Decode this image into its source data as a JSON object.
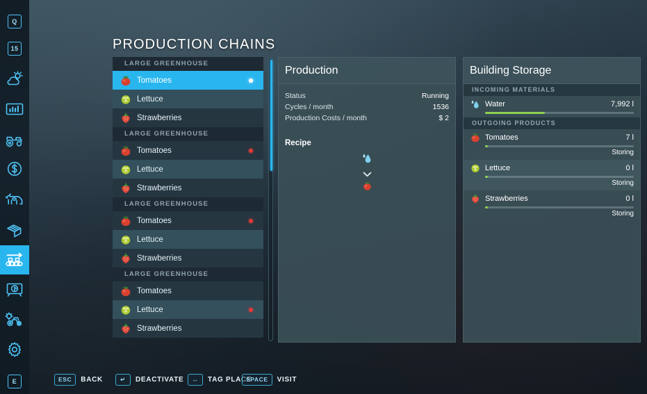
{
  "page": {
    "title": "PRODUCTION CHAINS"
  },
  "sidebar": {
    "items": [
      {
        "name": "quests-icon",
        "label": "Q",
        "active": false
      },
      {
        "name": "calendar-icon",
        "label": "15",
        "active": false
      },
      {
        "name": "weather-icon",
        "label": "",
        "active": false
      },
      {
        "name": "statistics-icon",
        "label": "",
        "active": false
      },
      {
        "name": "vehicles-icon",
        "label": "",
        "active": false
      },
      {
        "name": "finances-icon",
        "label": "",
        "active": false
      },
      {
        "name": "animals-icon",
        "label": "",
        "active": false
      },
      {
        "name": "contracts-icon",
        "label": "",
        "active": false
      },
      {
        "name": "production-chains-icon",
        "label": "",
        "active": true
      },
      {
        "name": "construction-icon",
        "label": "",
        "active": false
      },
      {
        "name": "ai-workers-icon",
        "label": "",
        "active": false
      },
      {
        "name": "settings-icon",
        "label": "",
        "active": false
      },
      {
        "name": "help-key-icon",
        "label": "E",
        "active": false
      }
    ]
  },
  "chain_list": {
    "groups": [
      {
        "header": "LARGE GREENHOUSE",
        "rows": [
          {
            "label": "Tomatoes",
            "icon": "tomato",
            "state": "selected",
            "dot": "white"
          },
          {
            "label": "Lettuce",
            "icon": "lettuce",
            "state": "even",
            "dot": "none"
          },
          {
            "label": "Strawberries",
            "icon": "strawberry",
            "state": "odd",
            "dot": "none"
          }
        ]
      },
      {
        "header": "LARGE GREENHOUSE",
        "rows": [
          {
            "label": "Tomatoes",
            "icon": "tomato",
            "state": "odd",
            "dot": "red"
          },
          {
            "label": "Lettuce",
            "icon": "lettuce",
            "state": "even",
            "dot": "none"
          },
          {
            "label": "Strawberries",
            "icon": "strawberry",
            "state": "odd",
            "dot": "none"
          }
        ]
      },
      {
        "header": "LARGE GREENHOUSE",
        "rows": [
          {
            "label": "Tomatoes",
            "icon": "tomato",
            "state": "odd",
            "dot": "red"
          },
          {
            "label": "Lettuce",
            "icon": "lettuce",
            "state": "even",
            "dot": "none"
          },
          {
            "label": "Strawberries",
            "icon": "strawberry",
            "state": "odd",
            "dot": "none"
          }
        ]
      },
      {
        "header": "LARGE GREENHOUSE",
        "rows": [
          {
            "label": "Tomatoes",
            "icon": "tomato",
            "state": "odd",
            "dot": "none"
          },
          {
            "label": "Lettuce",
            "icon": "lettuce",
            "state": "even",
            "dot": "red"
          },
          {
            "label": "Strawberries",
            "icon": "strawberry",
            "state": "odd",
            "dot": "none"
          }
        ]
      }
    ]
  },
  "production": {
    "title": "Production",
    "stats": [
      {
        "label": "Status",
        "value": "Running"
      },
      {
        "label": "Cycles / month",
        "value": "1536"
      },
      {
        "label": "Production Costs / month",
        "value": "$ 2"
      }
    ],
    "recipe_label": "Recipe",
    "recipe": {
      "input_icon": "water-drop",
      "arrow_icon": "chevron-down",
      "output_icon": "tomato"
    }
  },
  "storage": {
    "title": "Building Storage",
    "incoming_header": "INCOMING MATERIALS",
    "incoming": [
      {
        "name": "Water",
        "icon": "water-drop",
        "amount": "7,992 l",
        "fill_pct": 40,
        "status": ""
      }
    ],
    "outgoing_header": "OUTGOING PRODUCTS",
    "outgoing": [
      {
        "name": "Tomatoes",
        "icon": "tomato",
        "amount": "7 l",
        "fill_pct": 2,
        "status": "Storing"
      },
      {
        "name": "Lettuce",
        "icon": "lettuce",
        "amount": "0 l",
        "fill_pct": 2,
        "status": "Storing"
      },
      {
        "name": "Strawberries",
        "icon": "strawberry",
        "amount": "0 l",
        "fill_pct": 2,
        "status": "Storing"
      }
    ]
  },
  "hints": [
    {
      "key": "ESC",
      "action": "BACK"
    },
    {
      "key": "↵",
      "action": "DEACTIVATE"
    },
    {
      "key": "↔",
      "action": "TAG PLACE"
    },
    {
      "key": "SPACE",
      "action": "VISIT"
    }
  ],
  "colors": {
    "accent": "#29b6ef",
    "panel": "#3a4f56",
    "bar_green": "#8fd14f",
    "dot_red": "#e53935",
    "sidebar_bg": "#16232c"
  }
}
